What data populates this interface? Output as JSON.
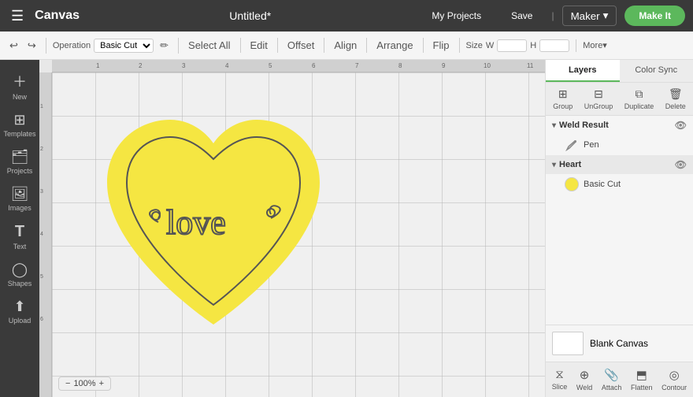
{
  "app": {
    "name": "Canvas",
    "title": "Untitled*"
  },
  "nav": {
    "menu_icon": "☰",
    "logo": "Canvas",
    "title": "Untitled*",
    "my_projects": "My Projects",
    "save": "Save",
    "divider": "|",
    "maker": "Maker",
    "make_it": "Make It"
  },
  "toolbar": {
    "operation_label": "Operation",
    "operation_value": "Basic Cut",
    "select_all": "Select All",
    "edit": "Edit",
    "offset_label": "Offset",
    "align_label": "Align",
    "arrange_label": "Arrange",
    "flip_label": "Flip",
    "size_label": "Size",
    "w_label": "W",
    "h_label": "H",
    "more": "More▾"
  },
  "sidebar": {
    "items": [
      {
        "label": "New",
        "icon": "+"
      },
      {
        "label": "Templates",
        "icon": "⊞"
      },
      {
        "label": "Projects",
        "icon": "📁"
      },
      {
        "label": "Images",
        "icon": "🖼"
      },
      {
        "label": "Text",
        "icon": "T"
      },
      {
        "label": "Shapes",
        "icon": "◯"
      },
      {
        "label": "Upload",
        "icon": "⬆"
      }
    ]
  },
  "right_panel": {
    "tabs": [
      {
        "label": "Layers",
        "active": true
      },
      {
        "label": "Color Sync",
        "active": false
      }
    ],
    "tools": [
      {
        "label": "Group",
        "disabled": false
      },
      {
        "label": "UnGroup",
        "disabled": false
      },
      {
        "label": "Duplicate",
        "disabled": false
      },
      {
        "label": "Delete",
        "disabled": false
      }
    ],
    "layers": [
      {
        "name": "Weld Result",
        "expanded": true,
        "items": [
          {
            "label": "Pen",
            "color": "#888"
          }
        ]
      },
      {
        "name": "Heart",
        "expanded": true,
        "items": [
          {
            "label": "Basic Cut",
            "color": "#f5e642"
          }
        ]
      }
    ],
    "blank_canvas": "Blank Canvas"
  },
  "bottom_tools": [
    {
      "label": "Slice"
    },
    {
      "label": "Weld"
    },
    {
      "label": "Attach"
    },
    {
      "label": "Flatten"
    },
    {
      "label": "Contour"
    }
  ],
  "zoom": "100%"
}
